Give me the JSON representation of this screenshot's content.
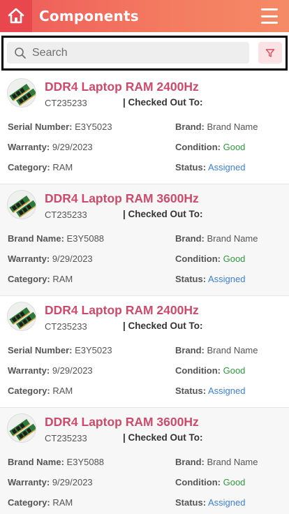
{
  "header": {
    "title": "Components",
    "home_icon": "home-icon",
    "menu_icon": "hamburger-menu-icon",
    "accent": "#ee5a5a"
  },
  "search": {
    "placeholder": "Search"
  },
  "labels": {
    "checked_out": "| Checked Out To:",
    "warranty": "Warranty:",
    "category": "Category:",
    "brand": "Brand:",
    "condition": "Condition:",
    "status": "Status:"
  },
  "items": [
    {
      "name": "DDR4 Laptop RAM 2400Hz",
      "code": "CT235233",
      "id_label": "Serial Number:",
      "id_value": "E3Y5023",
      "warranty": "9/29/2023",
      "category": "RAM",
      "brand": "Brand Name",
      "condition": "Good",
      "status": "Assigned"
    },
    {
      "name": "DDR4 Laptop RAM 3600Hz",
      "code": "CT235233",
      "id_label": "Brand Name:",
      "id_value": "E3Y5088",
      "warranty": "9/29/2023",
      "category": "RAM",
      "brand": "Brand Name",
      "condition": "Good",
      "status": "Assigned"
    },
    {
      "name": "DDR4 Laptop RAM 2400Hz",
      "code": "CT235233",
      "id_label": "Serial Number:",
      "id_value": "E3Y5023",
      "warranty": "9/29/2023",
      "category": "RAM",
      "brand": "Brand Name",
      "condition": "Good",
      "status": "Assigned"
    },
    {
      "name": "DDR4 Laptop RAM 3600Hz",
      "code": "CT235233",
      "id_label": "Brand Name:",
      "id_value": "E3Y5088",
      "warranty": "9/29/2023",
      "category": "RAM",
      "brand": "Brand Name",
      "condition": "Good",
      "status": "Assigned"
    }
  ]
}
